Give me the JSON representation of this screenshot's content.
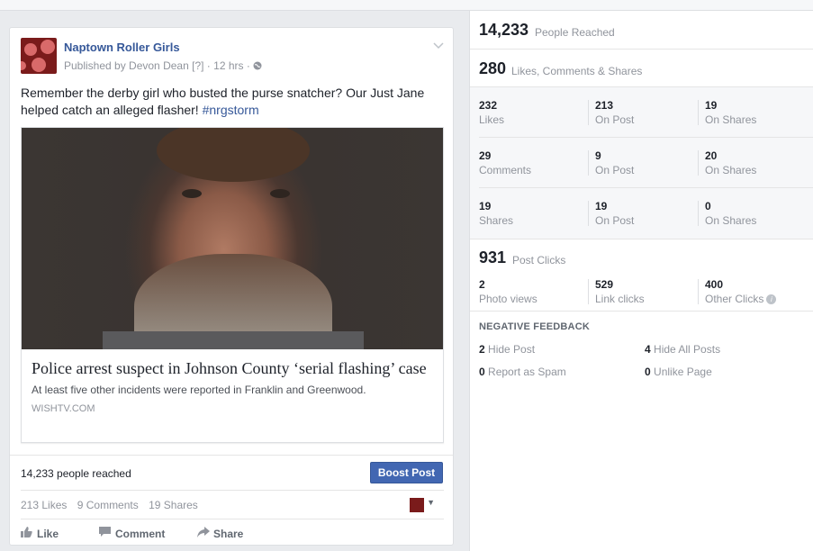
{
  "post": {
    "page_name": "Naptown Roller Girls",
    "published_by": "Published by Devon Dean",
    "help_marker": "[?]",
    "time": "12 hrs",
    "separator": "·",
    "privacy_icon": "globe-icon",
    "text": "Remember the derby girl who busted the purse snatcher? Our Just Jane helped catch an alleged flasher!",
    "hashtag": "#nrgstorm",
    "link": {
      "title": "Police arrest suspect in Johnson County ‘serial flashing’ case",
      "description": "At least five other incidents were reported in Franklin and Greenwood.",
      "domain": "WISHTV.COM"
    },
    "reached": "14,233 people reached",
    "boost_label": "Boost Post",
    "likes": "213 Likes",
    "comments": "9 Comments",
    "shares": "19 Shares",
    "actions": {
      "like": "Like",
      "comment": "Comment",
      "share": "Share"
    }
  },
  "insights": {
    "reach": {
      "value": "14,233",
      "label": "People Reached"
    },
    "engagement": {
      "value": "280",
      "label": "Likes, Comments & Shares"
    },
    "breakdown": [
      [
        {
          "n": "232",
          "l": "Likes"
        },
        {
          "n": "213",
          "l": "On Post"
        },
        {
          "n": "19",
          "l": "On Shares"
        }
      ],
      [
        {
          "n": "29",
          "l": "Comments"
        },
        {
          "n": "9",
          "l": "On Post"
        },
        {
          "n": "20",
          "l": "On Shares"
        }
      ],
      [
        {
          "n": "19",
          "l": "Shares"
        },
        {
          "n": "19",
          "l": "On Post"
        },
        {
          "n": "0",
          "l": "On Shares"
        }
      ]
    ],
    "clicks": {
      "value": "931",
      "label": "Post Clicks"
    },
    "click_breakdown": [
      {
        "n": "2",
        "l": "Photo views"
      },
      {
        "n": "529",
        "l": "Link clicks"
      },
      {
        "n": "400",
        "l": "Other Clicks"
      }
    ],
    "negative": {
      "title": "NEGATIVE FEEDBACK",
      "hide_post": {
        "n": "2",
        "l": "Hide Post"
      },
      "hide_all": {
        "n": "4",
        "l": "Hide All Posts"
      },
      "spam": {
        "n": "0",
        "l": "Report as Spam"
      },
      "unlike": {
        "n": "0",
        "l": "Unlike Page"
      }
    }
  }
}
